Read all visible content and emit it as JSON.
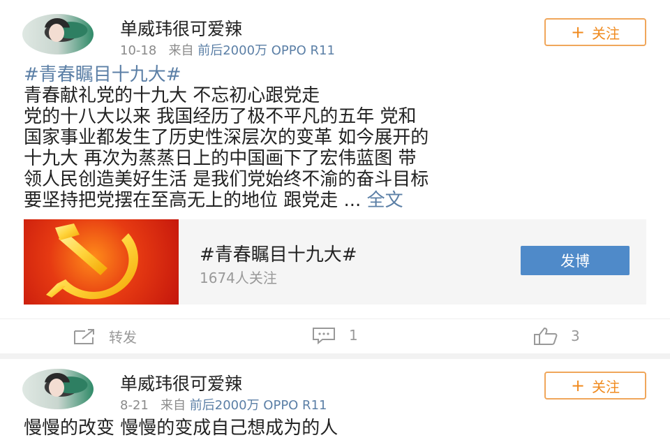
{
  "posts": [
    {
      "author": "单威玮很可爱辣",
      "date": "10-18",
      "via": "来自",
      "source": "前后2000万 OPPO R11",
      "follow_label": "关注",
      "topic": "#青春瞩目十九大#",
      "lines": [
        "青春献礼党的十九大 不忘初心跟党走",
        "党的十八大以来 我国经历了极不平凡的五年 党和",
        "国家事业都发生了历史性深层次的变革 如今展开的",
        "十九大 再次为蒸蒸日上的中国画下了宏伟蓝图 带",
        "领人民创造美好生活 是我们党始终不渝的奋斗目标",
        "要坚持把党摆在至高无上的地位 跟党走 ..."
      ],
      "full_text_link": "全文",
      "card": {
        "title": "#青春瞩目十九大#",
        "followers": "1674人关注",
        "button": "发博"
      },
      "actions": {
        "repost_label": "转发",
        "comment_count": "1",
        "like_count": "3"
      }
    },
    {
      "author": "单威玮很可爱辣",
      "date": "8-21",
      "via": "来自",
      "source": "前后2000万 OPPO R11",
      "follow_label": "关注",
      "text": "慢慢的改变 慢慢的变成自己想成为的人"
    }
  ],
  "icons": {
    "plus": "plus-icon",
    "repost": "repost-icon",
    "comment": "comment-icon",
    "like": "like-icon"
  },
  "colors": {
    "accent_orange": "#f08a1e",
    "link_blue": "#5b7fa6",
    "button_blue": "#4f8ac9"
  }
}
